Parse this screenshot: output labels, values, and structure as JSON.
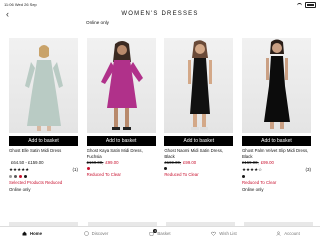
{
  "status_bar": {
    "time_date": "11:06  Wed 26 Sep",
    "battery": ""
  },
  "header": {
    "title": "WOMEN'S DRESSES",
    "back_icon": "chevron-left-icon"
  },
  "top_note": "Online only",
  "products": [
    {
      "name": "Ghost Elle Satin Midi Dress",
      "was": "",
      "price": "£64.50 - £159.00",
      "stars": "★★★★★",
      "reviews": "(1)",
      "swatches": [
        "#9a9a9a",
        "#5a5a5a",
        "#c8102e",
        "#1a1a1a"
      ],
      "promo": "Selected Products Reduced",
      "availability": "Online only",
      "button": "Add to basket"
    },
    {
      "name": "Ghost Kaya Satin Midi Dress, Fuchsia",
      "was": "£169.00,",
      "price": "£99.00",
      "stars": "",
      "reviews": "",
      "swatches": [
        "#c8102e"
      ],
      "promo": "Reduced To Clear",
      "availability": "",
      "button": "Add to basket"
    },
    {
      "name": "Ghost Naomi Midi Satin Dress, Black",
      "was": "£169.00,",
      "price": "£99.00",
      "stars": "",
      "reviews": "",
      "swatches": [
        "#1a1a1a"
      ],
      "promo": "Reduced To Clear",
      "availability": "",
      "button": "Add to basket"
    },
    {
      "name": "Ghost Palm Velvet Slip Midi Dress, Black",
      "was": "£169.00,",
      "price": "£99.00",
      "stars": "★★★★☆",
      "reviews": "(3)",
      "swatches": [
        "#1a1a1a"
      ],
      "promo": "Reduced To Clear",
      "availability": "Online only",
      "button": "Add to basket"
    }
  ],
  "tabs": [
    {
      "label": "Home",
      "icon": "home-icon",
      "active": true
    },
    {
      "label": "Discover",
      "icon": "discover-icon",
      "active": false
    },
    {
      "label": "Basket",
      "icon": "basket-icon",
      "active": false,
      "badge": "0"
    },
    {
      "label": "Wish List",
      "icon": "heart-icon",
      "active": false
    },
    {
      "label": "Account",
      "icon": "account-icon",
      "active": false
    }
  ],
  "colors": {
    "accent_red": "#c8102e",
    "button_black": "#000000"
  }
}
